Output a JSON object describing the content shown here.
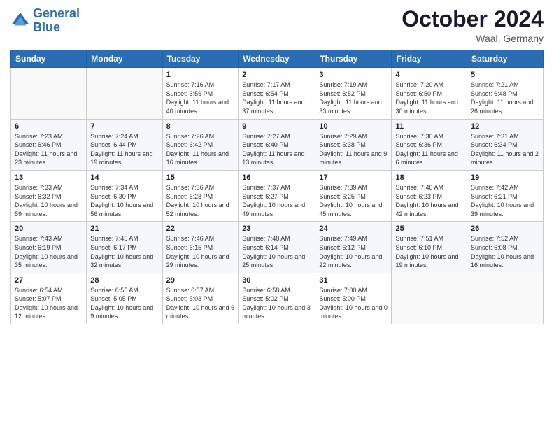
{
  "header": {
    "logo_line1": "General",
    "logo_line2": "Blue",
    "month_title": "October 2024",
    "location": "Waal, Germany"
  },
  "weekdays": [
    "Sunday",
    "Monday",
    "Tuesday",
    "Wednesday",
    "Thursday",
    "Friday",
    "Saturday"
  ],
  "weeks": [
    [
      {
        "day": "",
        "info": ""
      },
      {
        "day": "",
        "info": ""
      },
      {
        "day": "1",
        "info": "Sunrise: 7:16 AM\nSunset: 6:56 PM\nDaylight: 11 hours and 40 minutes."
      },
      {
        "day": "2",
        "info": "Sunrise: 7:17 AM\nSunset: 6:54 PM\nDaylight: 11 hours and 37 minutes."
      },
      {
        "day": "3",
        "info": "Sunrise: 7:19 AM\nSunset: 6:52 PM\nDaylight: 11 hours and 33 minutes."
      },
      {
        "day": "4",
        "info": "Sunrise: 7:20 AM\nSunset: 6:50 PM\nDaylight: 11 hours and 30 minutes."
      },
      {
        "day": "5",
        "info": "Sunrise: 7:21 AM\nSunset: 6:48 PM\nDaylight: 11 hours and 26 minutes."
      }
    ],
    [
      {
        "day": "6",
        "info": "Sunrise: 7:23 AM\nSunset: 6:46 PM\nDaylight: 11 hours and 23 minutes."
      },
      {
        "day": "7",
        "info": "Sunrise: 7:24 AM\nSunset: 6:44 PM\nDaylight: 11 hours and 19 minutes."
      },
      {
        "day": "8",
        "info": "Sunrise: 7:26 AM\nSunset: 6:42 PM\nDaylight: 11 hours and 16 minutes."
      },
      {
        "day": "9",
        "info": "Sunrise: 7:27 AM\nSunset: 6:40 PM\nDaylight: 11 hours and 13 minutes."
      },
      {
        "day": "10",
        "info": "Sunrise: 7:29 AM\nSunset: 6:38 PM\nDaylight: 11 hours and 9 minutes."
      },
      {
        "day": "11",
        "info": "Sunrise: 7:30 AM\nSunset: 6:36 PM\nDaylight: 11 hours and 6 minutes."
      },
      {
        "day": "12",
        "info": "Sunrise: 7:31 AM\nSunset: 6:34 PM\nDaylight: 11 hours and 2 minutes."
      }
    ],
    [
      {
        "day": "13",
        "info": "Sunrise: 7:33 AM\nSunset: 6:32 PM\nDaylight: 10 hours and 59 minutes."
      },
      {
        "day": "14",
        "info": "Sunrise: 7:34 AM\nSunset: 6:30 PM\nDaylight: 10 hours and 56 minutes."
      },
      {
        "day": "15",
        "info": "Sunrise: 7:36 AM\nSunset: 6:28 PM\nDaylight: 10 hours and 52 minutes."
      },
      {
        "day": "16",
        "info": "Sunrise: 7:37 AM\nSunset: 6:27 PM\nDaylight: 10 hours and 49 minutes."
      },
      {
        "day": "17",
        "info": "Sunrise: 7:39 AM\nSunset: 6:25 PM\nDaylight: 10 hours and 45 minutes."
      },
      {
        "day": "18",
        "info": "Sunrise: 7:40 AM\nSunset: 6:23 PM\nDaylight: 10 hours and 42 minutes."
      },
      {
        "day": "19",
        "info": "Sunrise: 7:42 AM\nSunset: 6:21 PM\nDaylight: 10 hours and 39 minutes."
      }
    ],
    [
      {
        "day": "20",
        "info": "Sunrise: 7:43 AM\nSunset: 6:19 PM\nDaylight: 10 hours and 35 minutes."
      },
      {
        "day": "21",
        "info": "Sunrise: 7:45 AM\nSunset: 6:17 PM\nDaylight: 10 hours and 32 minutes."
      },
      {
        "day": "22",
        "info": "Sunrise: 7:46 AM\nSunset: 6:15 PM\nDaylight: 10 hours and 29 minutes."
      },
      {
        "day": "23",
        "info": "Sunrise: 7:48 AM\nSunset: 6:14 PM\nDaylight: 10 hours and 25 minutes."
      },
      {
        "day": "24",
        "info": "Sunrise: 7:49 AM\nSunset: 6:12 PM\nDaylight: 10 hours and 22 minutes."
      },
      {
        "day": "25",
        "info": "Sunrise: 7:51 AM\nSunset: 6:10 PM\nDaylight: 10 hours and 19 minutes."
      },
      {
        "day": "26",
        "info": "Sunrise: 7:52 AM\nSunset: 6:08 PM\nDaylight: 10 hours and 16 minutes."
      }
    ],
    [
      {
        "day": "27",
        "info": "Sunrise: 6:54 AM\nSunset: 5:07 PM\nDaylight: 10 hours and 12 minutes."
      },
      {
        "day": "28",
        "info": "Sunrise: 6:55 AM\nSunset: 5:05 PM\nDaylight: 10 hours and 9 minutes."
      },
      {
        "day": "29",
        "info": "Sunrise: 6:57 AM\nSunset: 5:03 PM\nDaylight: 10 hours and 6 minutes."
      },
      {
        "day": "30",
        "info": "Sunrise: 6:58 AM\nSunset: 5:02 PM\nDaylight: 10 hours and 3 minutes."
      },
      {
        "day": "31",
        "info": "Sunrise: 7:00 AM\nSunset: 5:00 PM\nDaylight: 10 hours and 0 minutes."
      },
      {
        "day": "",
        "info": ""
      },
      {
        "day": "",
        "info": ""
      }
    ]
  ]
}
